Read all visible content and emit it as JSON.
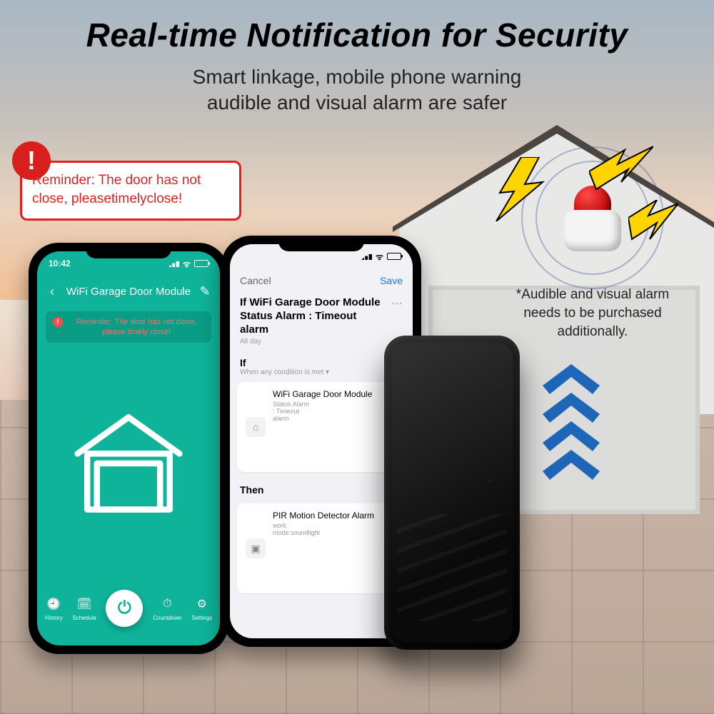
{
  "headline": "Real-time Notification for Security",
  "subline1": "Smart linkage, mobile phone warning",
  "subline2": "audible and visual alarm are safer",
  "callout": {
    "text": "Reminder: The door has not close, pleasetimelyclose!",
    "exclaim": "!"
  },
  "siren_note": "*Audible and visual alarm needs to be purchased additionally.",
  "phone1": {
    "time": "10:42",
    "title": "WiFi Garage Door Module",
    "banner": "Reminder: The door has not close, please timely close!",
    "bottom": {
      "history": "History",
      "schedule": "Schedule",
      "countdown": "Countdown",
      "settings": "Settings"
    }
  },
  "phone2": {
    "cancel": "Cancel",
    "save": "Save",
    "title": "If WiFi Garage Door Module Status Alarm : Timeout alarm",
    "allday": "All day",
    "if_label": "If",
    "if_sub": "When any condition is met ▾",
    "if_item_title": "WiFi Garage Door Module",
    "if_item_sub": "Status Alarm : Timeout alarm",
    "then_label": "Then",
    "then_item_title": "PIR Motion Detector Alarm",
    "then_item_sub": "work mode:soundlight"
  }
}
